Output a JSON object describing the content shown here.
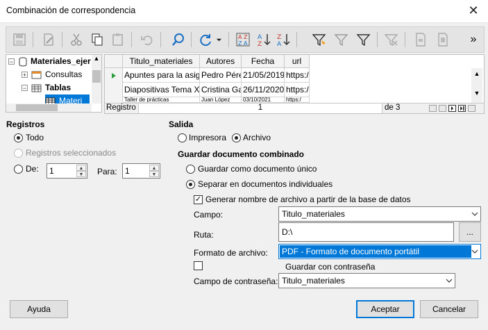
{
  "window": {
    "title": "Combinación de correspondencia"
  },
  "toolbar": {
    "buttons": [
      "save-icon",
      "edit-icon",
      "cut-icon",
      "copy-icon",
      "paste-icon",
      "undo-icon",
      "find-icon",
      "refresh-icon",
      "sort-icon",
      "sort-ascending-icon",
      "sort-descending-icon",
      "autofilter-icon",
      "standard-filter-icon",
      "filter-icon",
      "remove-filter-icon",
      "data-to-text-icon",
      "data-to-fields-icon",
      "more-icon"
    ]
  },
  "tree": {
    "database": "Materiales_ejer",
    "queries": "Consultas",
    "tables": "Tablas",
    "selected_table": "Materi"
  },
  "grid": {
    "columns": [
      "Titulo_materiales",
      "Autores",
      "Fecha",
      "url"
    ],
    "rows": [
      [
        "Apuntes para la asignatura",
        "Pedro Pérez",
        "21/05/2019",
        "https:/"
      ],
      [
        "Diapositivas Tema X",
        "Cristina García",
        "26/11/2020",
        "https:/"
      ],
      [
        "Taller de prácticas",
        "Juan López",
        "03/10/2021",
        "https:/"
      ]
    ],
    "nav": {
      "record_label": "Registro",
      "record_value": "1",
      "of_label": "de 3"
    }
  },
  "records": {
    "heading": "Registros",
    "all": "Todo",
    "selected": "Registros seleccionados",
    "from": "De:",
    "from_value": "1",
    "to": "Para:",
    "to_value": "1"
  },
  "output": {
    "heading": "Salida",
    "printer": "Impresora",
    "file": "Archivo",
    "save_heading": "Guardar documento combinado",
    "single_doc": "Guardar como documento único",
    "individual_docs": "Separar en documentos individuales",
    "generate_name": "Generar nombre de archivo a partir de la base de datos",
    "field_label": "Campo:",
    "field_value": "Titulo_materiales",
    "path_label": "Ruta:",
    "path_value": "D:\\",
    "browse": "...",
    "format_label": "Formato de archivo:",
    "format_value": "PDF - Formato de documento portátil",
    "save_password": "Guardar con contraseña",
    "password_field_label": "Campo de contraseña:",
    "password_field_value": "Titulo_materiales"
  },
  "footer": {
    "help": "Ayuda",
    "ok": "Aceptar",
    "cancel": "Cancelar"
  },
  "colors": {
    "accent": "#0078d7"
  }
}
